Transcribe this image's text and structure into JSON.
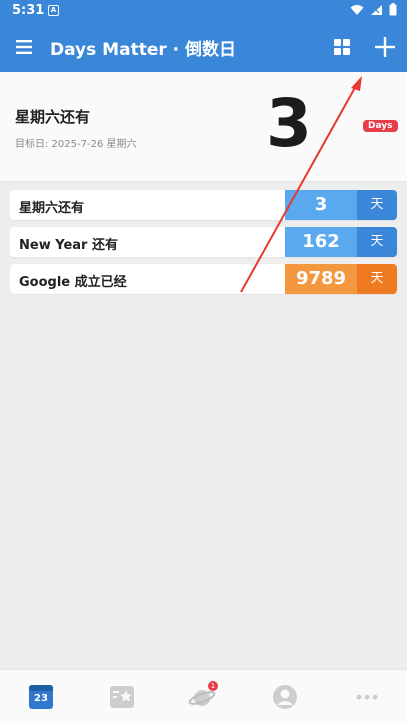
{
  "status_bar": {
    "time": "5:31",
    "notification_letter": "A"
  },
  "app_bar": {
    "title": "Days Matter · 倒数日"
  },
  "hero": {
    "event_name": "星期六还有",
    "target_date": "目标日: 2025-7-26 星期六",
    "days": "3",
    "badge": "Days"
  },
  "events": [
    {
      "name": "星期六还有",
      "count": "3",
      "unit": "天",
      "count_color": "#5aa9ef",
      "unit_color": "#3a86d8"
    },
    {
      "name": "New Year 还有",
      "count": "162",
      "unit": "天",
      "count_color": "#5aa9ef",
      "unit_color": "#3a86d8"
    },
    {
      "name": "Google 成立已经",
      "count": "9789",
      "unit": "天",
      "count_color": "#f4983f",
      "unit_color": "#ee7b22"
    }
  ],
  "bottom_nav": {
    "items": [
      "calendar",
      "favorites",
      "discover",
      "profile",
      "more"
    ],
    "calendar_day": "23",
    "discover_badge": "1"
  },
  "colors": {
    "primary": "#3a86d8",
    "accent_red": "#e63d49",
    "annotation_arrow": "#e8382f"
  }
}
